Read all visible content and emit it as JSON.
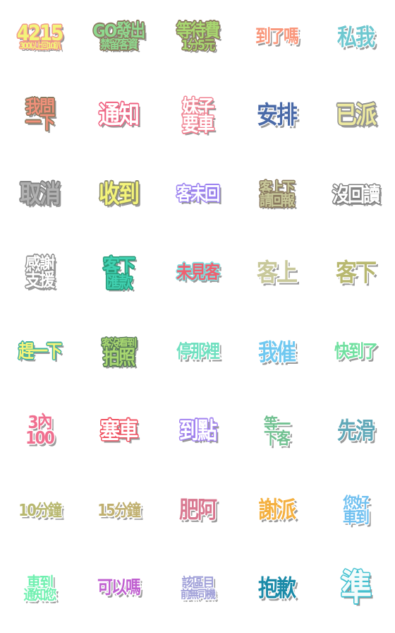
{
  "stickers": [
    {
      "lines": [
        "4215",
        "300以上回10趴"
      ],
      "color": "#f4f47a",
      "outline": "#f09a8a",
      "sizes": [
        26,
        10
      ]
    },
    {
      "lines": [
        "GO發出",
        "禁留客資"
      ],
      "color": "#8fd88f",
      "outline": "#8a7a60",
      "sizes": [
        22,
        15
      ]
    },
    {
      "lines": [
        "等待費",
        "1分5元"
      ],
      "color": "#a8d870",
      "outline": "#8a7a60",
      "sizes": [
        22,
        16
      ]
    },
    {
      "lines": [
        "到了嗎"
      ],
      "color": "#f9967a",
      "outline": "#ffffff",
      "sizes": [
        22
      ]
    },
    {
      "lines": [
        "私我"
      ],
      "color": "#6fc8d0",
      "outline": "#ffffff",
      "sizes": [
        28
      ]
    },
    {
      "lines": [
        "我問",
        "一下"
      ],
      "color": "#f0907a",
      "outline": "#8a7a60",
      "sizes": [
        22,
        22
      ]
    },
    {
      "lines": [
        "通知"
      ],
      "color": "#ffffff",
      "outline": "#f06080",
      "sizes": [
        30
      ]
    },
    {
      "lines": [
        "妹子",
        "要車"
      ],
      "color": "#ffffff",
      "outline": "#f08090",
      "sizes": [
        24,
        24
      ]
    },
    {
      "lines": [
        "安排"
      ],
      "color": "#4a6aa8",
      "outline": "#ffffff",
      "sizes": [
        30
      ]
    },
    {
      "lines": [
        "已派"
      ],
      "color": "#eeeaa0",
      "outline": "#909090",
      "sizes": [
        30
      ]
    },
    {
      "lines": [
        "取消"
      ],
      "color": "#b0b0b0",
      "outline": "#808080",
      "sizes": [
        30
      ]
    },
    {
      "lines": [
        "收到"
      ],
      "color": "#f4f47a",
      "outline": "#8a8a6a",
      "sizes": [
        30
      ]
    },
    {
      "lines": [
        "客未回"
      ],
      "color": "#ffffff",
      "outline": "#9a80f0",
      "sizes": [
        22
      ]
    },
    {
      "lines": [
        "客上下",
        "請回報"
      ],
      "color": "#c8c89a",
      "outline": "#8a7a60",
      "sizes": [
        18,
        18
      ]
    },
    {
      "lines": [
        "沒回讀"
      ],
      "color": "#ffffff",
      "outline": "#808080",
      "sizes": [
        24
      ]
    },
    {
      "lines": [
        "感謝",
        "支援"
      ],
      "color": "#ffffff",
      "outline": "#909090",
      "sizes": [
        22,
        22
      ]
    },
    {
      "lines": [
        "客下",
        "匯款"
      ],
      "color": "#40d0b0",
      "outline": "#2a9a7a",
      "sizes": [
        24,
        20
      ]
    },
    {
      "lines": [
        "未見客"
      ],
      "color": "#f06070",
      "outline": "#80e0e0",
      "sizes": [
        22
      ]
    },
    {
      "lines": [
        "客上"
      ],
      "color": "#c8c89a",
      "outline": "#ffffff",
      "sizes": [
        30
      ]
    },
    {
      "lines": [
        "客下"
      ],
      "color": "#b8b870",
      "outline": "#ffffff",
      "sizes": [
        30
      ]
    },
    {
      "lines": [
        "趕一下"
      ],
      "color": "#f4f47a",
      "outline": "#40b0a0",
      "sizes": [
        22
      ]
    },
    {
      "lines": [
        "客沒看到",
        "拍照"
      ],
      "color": "#a8d870",
      "outline": "#5a7a5a",
      "sizes": [
        14,
        24
      ]
    },
    {
      "lines": [
        "停那裡"
      ],
      "color": "#70e0c0",
      "outline": "#ffffff",
      "sizes": [
        22
      ]
    },
    {
      "lines": [
        "我催"
      ],
      "color": "#70c8f0",
      "outline": "#ffffff",
      "sizes": [
        28
      ]
    },
    {
      "lines": [
        "快到了"
      ],
      "color": "#70e0a0",
      "outline": "#ffffff",
      "sizes": [
        22
      ]
    },
    {
      "lines": [
        "3內",
        "100"
      ],
      "color": "#f07090",
      "outline": "#ffffff",
      "sizes": [
        22,
        22
      ]
    },
    {
      "lines": [
        "塞車"
      ],
      "color": "#ffffff",
      "outline": "#f05060",
      "sizes": [
        28
      ]
    },
    {
      "lines": [
        "到點"
      ],
      "color": "#ffffff",
      "outline": "#a080f0",
      "sizes": [
        28
      ]
    },
    {
      "lines": [
        "等一",
        "下客"
      ],
      "color": "#70c090",
      "outline": "#ffffff",
      "sizes": [
        20,
        20
      ]
    },
    {
      "lines": [
        "先滑"
      ],
      "color": "#60a8b8",
      "outline": "#ffffff",
      "sizes": [
        28
      ]
    },
    {
      "lines": [
        "10分鐘"
      ],
      "color": "#b8b870",
      "outline": "#ffffff",
      "sizes": [
        20
      ]
    },
    {
      "lines": [
        "15分鐘"
      ],
      "color": "#c0b070",
      "outline": "#ffffff",
      "sizes": [
        20
      ]
    },
    {
      "lines": [
        "肥阿"
      ],
      "color": "#d87890",
      "outline": "#ffffff",
      "sizes": [
        28
      ]
    },
    {
      "lines": [
        "謝派"
      ],
      "color": "#f4b040",
      "outline": "#ffffff",
      "sizes": [
        28
      ]
    },
    {
      "lines": [
        "您好",
        "車到"
      ],
      "color": "#70c0f0",
      "outline": "#ffffff",
      "sizes": [
        20,
        20
      ]
    },
    {
      "lines": [
        "車到",
        "通知您"
      ],
      "color": "#70f0b0",
      "outline": "#ffffff",
      "sizes": [
        20,
        17
      ]
    },
    {
      "lines": [
        "可以嗎"
      ],
      "color": "#c060d0",
      "outline": "#ffffff",
      "sizes": [
        22
      ]
    },
    {
      "lines": [
        "該區目",
        "前無司機"
      ],
      "color": "#a0a0d8",
      "outline": "#ffffff",
      "sizes": [
        17,
        14
      ]
    },
    {
      "lines": [
        "抱歉"
      ],
      "color": "#1a8aa8",
      "outline": "#ffffff",
      "sizes": [
        28
      ]
    },
    {
      "lines": [
        "準"
      ],
      "color": "#f4fbfb",
      "outline": "#40c0d0",
      "sizes": [
        44
      ]
    }
  ]
}
